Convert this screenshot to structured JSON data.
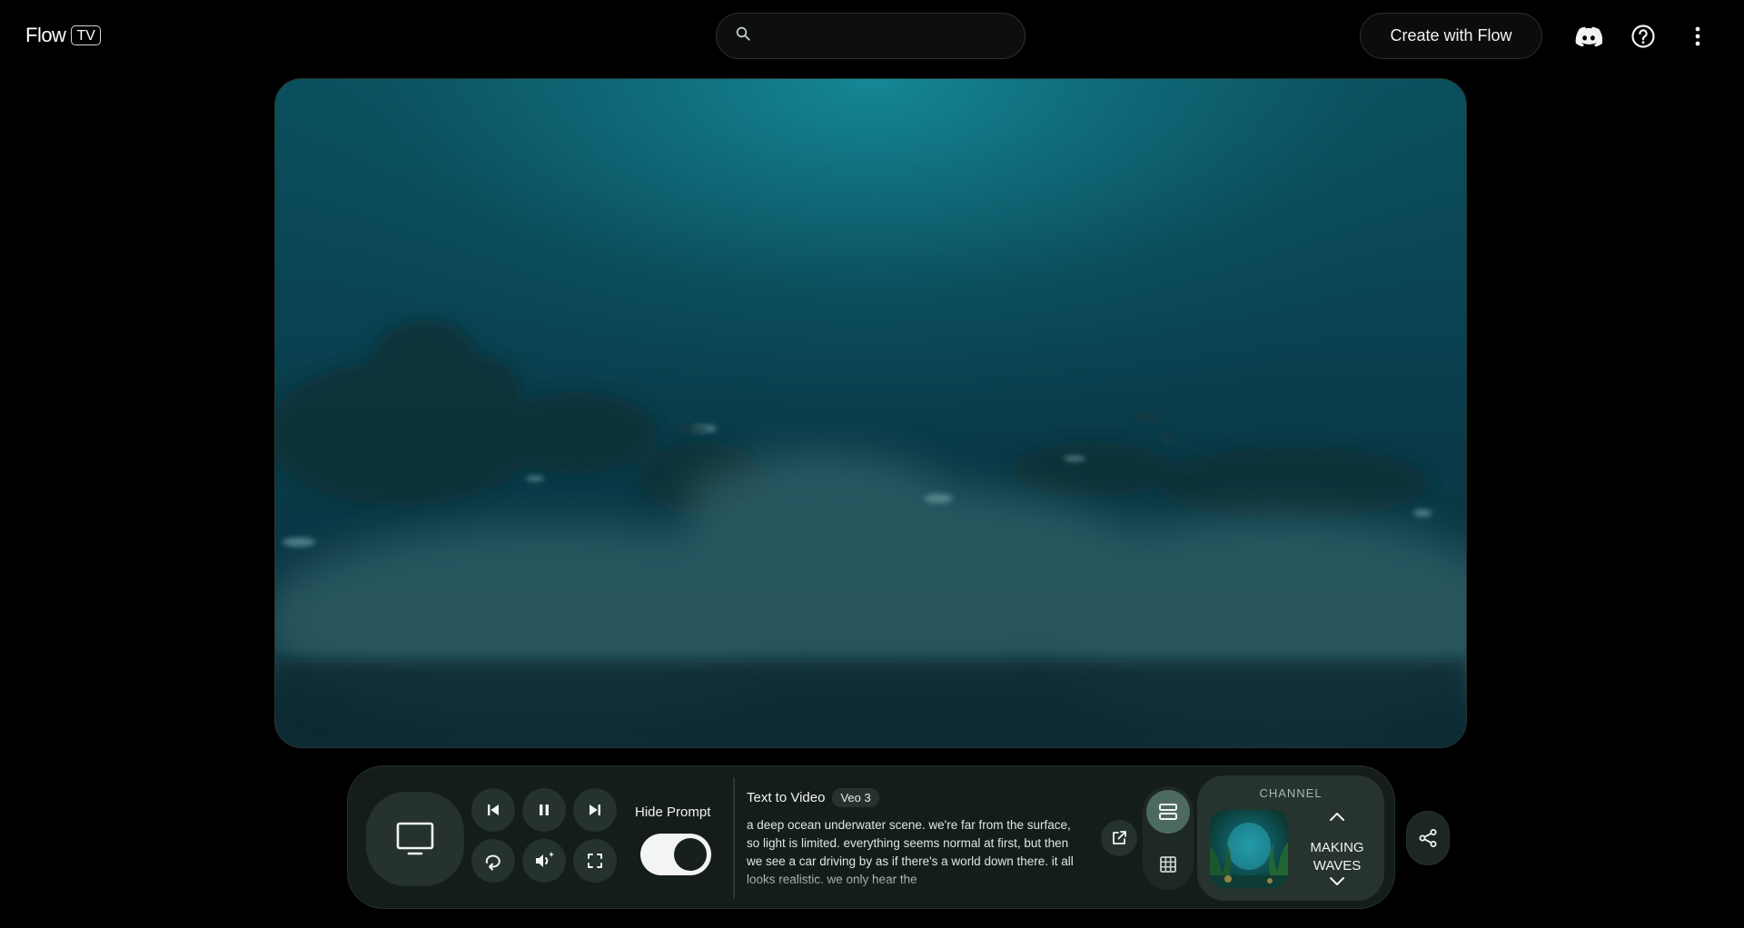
{
  "header": {
    "logo_word": "Flow",
    "logo_badge": "TV",
    "search_placeholder": "",
    "create_button": "Create with Flow",
    "icons": [
      "discord-icon",
      "help-icon",
      "more-vert-icon"
    ]
  },
  "player": {
    "hide_prompt_label": "Hide Prompt",
    "hide_prompt_on": true,
    "prompt_type": "Text to Video",
    "model": "Veo 3",
    "prompt_text": "a deep ocean underwater scene. we're far from the surface, so light is limited. everything seems normal at first, but then we see a car driving by as if there's a world down there. it all looks realistic. we only hear the"
  },
  "channel": {
    "label": "CHANNEL",
    "name": "MAKING WAVES"
  },
  "colors": {
    "background": "#000000",
    "control_bar": "#141d1a",
    "button": "#25322d",
    "active_view": "#4d6a60"
  }
}
